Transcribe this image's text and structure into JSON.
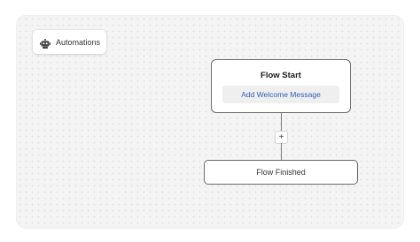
{
  "header": {
    "label": "Automations",
    "icon": "robot-icon"
  },
  "flow": {
    "start": {
      "title": "Flow Start",
      "action_label": "Add Welcome Message"
    },
    "add_step": {
      "symbol": "+"
    },
    "end": {
      "title": "Flow Finished"
    }
  },
  "colors": {
    "accent": "#2f5fb0",
    "node_border": "#6a6a6a",
    "canvas": "#f4f4f4"
  }
}
